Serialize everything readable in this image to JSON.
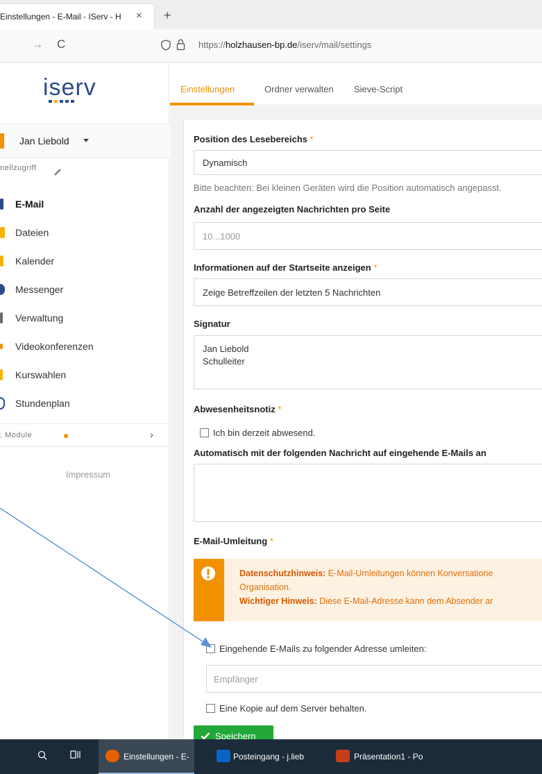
{
  "browser": {
    "tab_title": "Einstellungen - E-Mail - IServ - H",
    "tab_close": "×",
    "new_tab": "+",
    "nav_forward": "→",
    "nav_reload": "C",
    "url_prefix": "https://",
    "url_domain": "holzhausen-bp.de",
    "url_path": "/iserv/mail/settings"
  },
  "sidebar": {
    "user_name": "Jan Liebold",
    "quick_access": "nellzugriff",
    "items": [
      {
        "label": "E-Mail",
        "active": true,
        "color": "#2b4a8b"
      },
      {
        "label": "Dateien",
        "active": false,
        "color": "#f5b300"
      },
      {
        "label": "Kalender",
        "active": false,
        "color": "#f5b300"
      },
      {
        "label": "Messenger",
        "active": false,
        "color": "#2b4a8b"
      },
      {
        "label": "Verwaltung",
        "active": false,
        "color": "#6b6b6b"
      },
      {
        "label": "Videokonferenzen",
        "active": false,
        "color": "#f29100"
      },
      {
        "label": "Kurswahlen",
        "active": false,
        "color": "#f5b300"
      },
      {
        "label": "Stundenplan",
        "active": false,
        "color": "#2b4a8b"
      }
    ],
    "modules_label": "Module",
    "modules_chevron": "›",
    "impressum": "Impressum"
  },
  "tabs": [
    {
      "label": "Einstellungen",
      "active": true
    },
    {
      "label": "Ordner verwalten",
      "active": false
    },
    {
      "label": "Sieve-Script",
      "active": false
    }
  ],
  "form": {
    "reading_pane": {
      "label": "Position des Lesebereichs",
      "required": "*",
      "value": "Dynamisch",
      "help": "Bitte beachten: Bei kleinen Geräten wird die Position automatisch angepasst."
    },
    "messages_per_page": {
      "label": "Anzahl der angezeigten Nachrichten pro Seite",
      "placeholder": "10...1000"
    },
    "startpage_info": {
      "label": "Informationen auf der Startseite anzeigen",
      "required": "*",
      "value": "Zeige Betreffzeilen der letzten 5 Nachrichten"
    },
    "signature": {
      "label": "Signatur",
      "value": "Jan Liebold\nSchulleiter"
    },
    "absence": {
      "label": "Abwesenheitsnotiz",
      "required": "*",
      "checkbox_label": "Ich bin derzeit abwesend.",
      "checked": false
    },
    "auto_reply": {
      "label": "Automatisch mit der folgenden Nachricht auf eingehende E-Mails an",
      "value": ""
    },
    "redirect": {
      "label": "E-Mail-Umleitung",
      "required": "*",
      "alert_line1_bold": "Datenschutzhinweis:",
      "alert_line1_text": " E-Mail-Umleitungen können Konversatione",
      "alert_line2_text": "Organisation.",
      "alert_line3_bold": "Wichtiger Hinweis:",
      "alert_line3_text": " Diese E-Mail-Adresse kann dem Absender ar",
      "forward_checkbox_label": "Eingehende E-Mails zu folgender Adresse umleiten:",
      "forward_checked": false,
      "recipient_placeholder": "Empfänger",
      "keep_copy_label": "Eine Kopie auf dem Server behalten.",
      "keep_copy_checked": false
    },
    "save_label": "Speichern"
  },
  "taskbar": {
    "items": [
      {
        "label": "Einstellungen - E-",
        "active": true,
        "icon": "firefox-icon"
      },
      {
        "label": "Posteingang - j.lieb",
        "active": false,
        "icon": "outlook-icon"
      },
      {
        "label": "Präsentation1 - Po",
        "active": false,
        "icon": "powerpoint-icon"
      }
    ]
  },
  "colors": {
    "accent": "#f29100",
    "success": "#22a838",
    "brand_blue": "#2b4a8b"
  }
}
